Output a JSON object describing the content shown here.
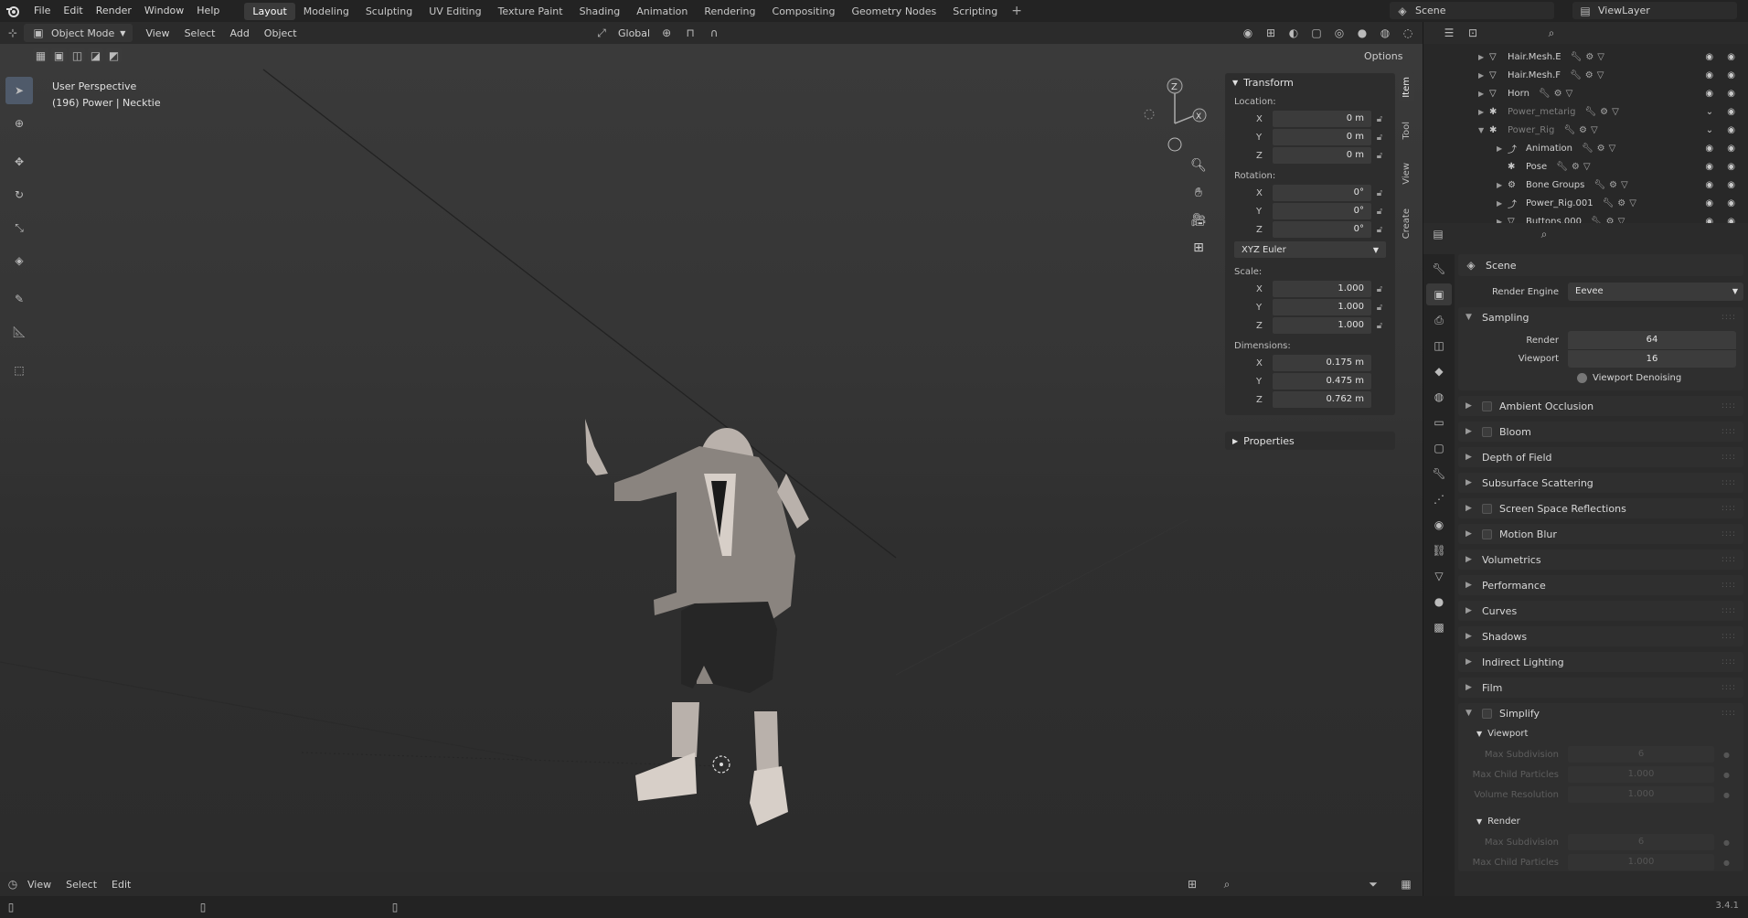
{
  "topbar": {
    "menus": [
      "File",
      "Edit",
      "Render",
      "Window",
      "Help"
    ],
    "workspaces": [
      "Layout",
      "Modeling",
      "Sculpting",
      "UV Editing",
      "Texture Paint",
      "Shading",
      "Animation",
      "Rendering",
      "Compositing",
      "Geometry Nodes",
      "Scripting"
    ],
    "active_workspace": "Layout",
    "scene": "Scene",
    "view_layer": "ViewLayer"
  },
  "viewport_header": {
    "mode": "Object Mode",
    "menus": [
      "View",
      "Select",
      "Add",
      "Object"
    ],
    "orientation": "Global",
    "options": "Options"
  },
  "viewport": {
    "perspective": "User Perspective",
    "context": "(196) Power | Necktie"
  },
  "npanel": {
    "transform_title": "Transform",
    "location_label": "Location:",
    "location": [
      {
        "axis": "X",
        "value": "0 m"
      },
      {
        "axis": "Y",
        "value": "0 m"
      },
      {
        "axis": "Z",
        "value": "0 m"
      }
    ],
    "rotation_label": "Rotation:",
    "rotation": [
      {
        "axis": "X",
        "value": "0°"
      },
      {
        "axis": "Y",
        "value": "0°"
      },
      {
        "axis": "Z",
        "value": "0°"
      }
    ],
    "rotation_mode": "XYZ Euler",
    "scale_label": "Scale:",
    "scale": [
      {
        "axis": "X",
        "value": "1.000"
      },
      {
        "axis": "Y",
        "value": "1.000"
      },
      {
        "axis": "Z",
        "value": "1.000"
      }
    ],
    "dimensions_label": "Dimensions:",
    "dimensions": [
      {
        "axis": "X",
        "value": "0.175 m"
      },
      {
        "axis": "Y",
        "value": "0.475 m"
      },
      {
        "axis": "Z",
        "value": "0.762 m"
      }
    ],
    "properties_title": "Properties",
    "tabs": [
      "Item",
      "Tool",
      "View",
      "Create"
    ]
  },
  "timeline": {
    "menus": [
      "View",
      "Select",
      "Edit"
    ]
  },
  "outliner": {
    "rows": [
      {
        "label": "Hair.Mesh.E",
        "indent": 0,
        "dim": false
      },
      {
        "label": "Hair.Mesh.F",
        "indent": 0,
        "dim": false
      },
      {
        "label": "Horn",
        "indent": 0,
        "dim": false
      },
      {
        "label": "Power_metarig",
        "indent": 0,
        "dim": true
      },
      {
        "label": "Power_Rig",
        "indent": 0,
        "dim": true
      },
      {
        "label": "Animation",
        "indent": 1,
        "dim": false
      },
      {
        "label": "Pose",
        "indent": 1,
        "dim": false
      },
      {
        "label": "Bone Groups",
        "indent": 1,
        "dim": false
      },
      {
        "label": "Power_Rig.001",
        "indent": 1,
        "dim": false
      },
      {
        "label": "Buttons.000",
        "indent": 1,
        "dim": false
      }
    ]
  },
  "properties": {
    "breadcrumb": "Scene",
    "render_engine_label": "Render Engine",
    "render_engine": "Eevee",
    "sampling": {
      "title": "Sampling",
      "render_label": "Render",
      "render_value": "64",
      "viewport_label": "Viewport",
      "viewport_value": "16",
      "denoise_label": "Viewport Denoising"
    },
    "panels": [
      {
        "title": "Ambient Occlusion",
        "check": true
      },
      {
        "title": "Bloom",
        "check": true
      },
      {
        "title": "Depth of Field",
        "check": false
      },
      {
        "title": "Subsurface Scattering",
        "check": false
      },
      {
        "title": "Screen Space Reflections",
        "check": true
      },
      {
        "title": "Motion Blur",
        "check": true
      },
      {
        "title": "Volumetrics",
        "check": false
      },
      {
        "title": "Performance",
        "check": false
      },
      {
        "title": "Curves",
        "check": false
      },
      {
        "title": "Shadows",
        "check": false
      },
      {
        "title": "Indirect Lighting",
        "check": false
      },
      {
        "title": "Film",
        "check": false
      }
    ],
    "simplify": {
      "title": "Simplify",
      "viewport_title": "Viewport",
      "viewport_rows": [
        {
          "label": "Max Subdivision",
          "value": "6"
        },
        {
          "label": "Max Child Particles",
          "value": "1.000"
        },
        {
          "label": "Volume Resolution",
          "value": "1.000"
        }
      ],
      "render_title": "Render",
      "render_rows": [
        {
          "label": "Max Subdivision",
          "value": "6"
        },
        {
          "label": "Max Child Particles",
          "value": "1.000"
        }
      ]
    }
  },
  "version": "3.4.1"
}
